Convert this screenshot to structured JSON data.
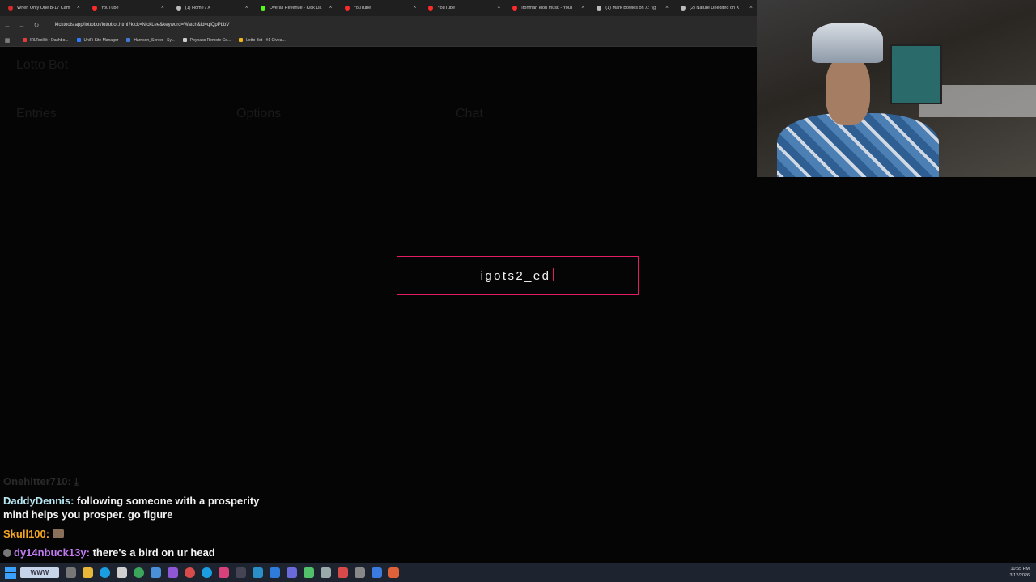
{
  "browser": {
    "tabs": [
      {
        "label": "When Only One B-17 Cam",
        "color": "#d52a2a"
      },
      {
        "label": "YouTube",
        "color": "#ff2a2a"
      },
      {
        "label": "(1) Home / X",
        "color": "#bbbbbb"
      },
      {
        "label": "Overall Revenue - Kick Da",
        "color": "#53fc18"
      },
      {
        "label": "YouTube",
        "color": "#ff2a2a"
      },
      {
        "label": "YouTube",
        "color": "#ff2a2a"
      },
      {
        "label": "ironman elon musk - YouT",
        "color": "#ff2a2a"
      },
      {
        "label": "(1) Mark Bowles on X: \"@",
        "color": "#bbbbbb"
      },
      {
        "label": "(2) Nature Unedited on X",
        "color": "#bbbbbb"
      }
    ],
    "url": "kicktools.app/lottobot/lottobot.html?kick=NickLee&keyword=Watch&id=qiQpPbbV",
    "bookmarks": [
      {
        "label": "IRLToolkit • Dashbo...",
        "color": "#e23c3c"
      },
      {
        "label": "UniFi Site Manager",
        "color": "#2f7bff"
      },
      {
        "label": "Harrison_Server - Sy...",
        "color": "#3d7bd6"
      },
      {
        "label": "Poynaps Remote Co...",
        "color": "#cccccc"
      },
      {
        "label": "Lotto Bot - #1 Givea...",
        "color": "#f2b31b"
      }
    ]
  },
  "modal": {
    "text": "igots2_ed",
    "border_color": "#e21d63"
  },
  "background_page": {
    "title": "Lotto Bot",
    "sections": [
      "Entries",
      "Options",
      "Chat"
    ]
  },
  "chat": [
    {
      "user": "Onehitter710:",
      "message": "",
      "user_color": "#555555",
      "dim": true
    },
    {
      "user": "DaddyDennis:",
      "message": "following someone with a prosperity mind helps you prosper. go figure",
      "user_color": "#b9e8f5"
    },
    {
      "user": "Skull100:",
      "message": "",
      "user_color": "#f5a623"
    },
    {
      "user": "dy14nbuck13y:",
      "message": "there's a bird on ur head",
      "user_color": "#c07bf3"
    }
  ],
  "taskbar": {
    "search_label": "WWW",
    "time": "10:55 PM",
    "date": "3/12/2026"
  }
}
